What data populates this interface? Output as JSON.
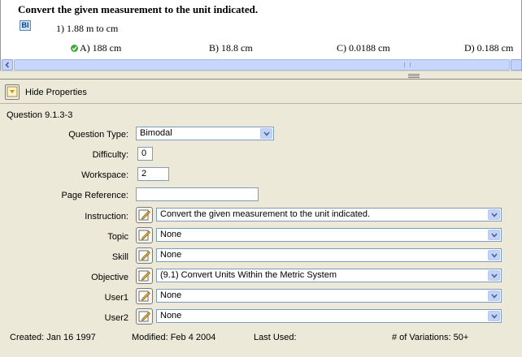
{
  "preview": {
    "instruction": "Convert the given measurement to the unit indicated.",
    "badge": "BI",
    "question": "1) 1.88 m to cm",
    "answers": [
      {
        "label": "A) 188 cm",
        "correct": true
      },
      {
        "label": "B) 18.8 cm",
        "correct": false
      },
      {
        "label": "C) 0.0188 cm",
        "correct": false
      },
      {
        "label": "D) 0.188 cm",
        "correct": false
      }
    ]
  },
  "properties": {
    "hide_button_label": "Hide Properties",
    "question_id": "Question  9.1.3-3",
    "labels": {
      "question_type": "Question Type:",
      "difficulty": "Difficulty:",
      "workspace": "Workspace:",
      "page_reference": "Page Reference:",
      "instruction": "Instruction:",
      "topic": "Topic",
      "skill": "Skill",
      "objective": "Objective",
      "user1": "User1",
      "user2": "User2"
    },
    "values": {
      "question_type": "Bimodal",
      "difficulty": "0",
      "workspace": "2",
      "page_reference": "",
      "instruction": "Convert the given measurement to the unit indicated.",
      "topic": "None",
      "skill": "None",
      "objective": "(9.1) Convert Units Within the Metric System",
      "user1": "None",
      "user2": "None"
    },
    "footer": {
      "created": "Created:  Jan 16 1997",
      "modified": "Modified:  Feb  4 2004",
      "last_used": "Last Used:",
      "variations": "# of Variations: 50+"
    }
  },
  "colors": {
    "panel": "#ece9d8",
    "field_border": "#7f9db9",
    "combo_button": "#c1d3fb",
    "correct_mark": "#3aa83a"
  }
}
